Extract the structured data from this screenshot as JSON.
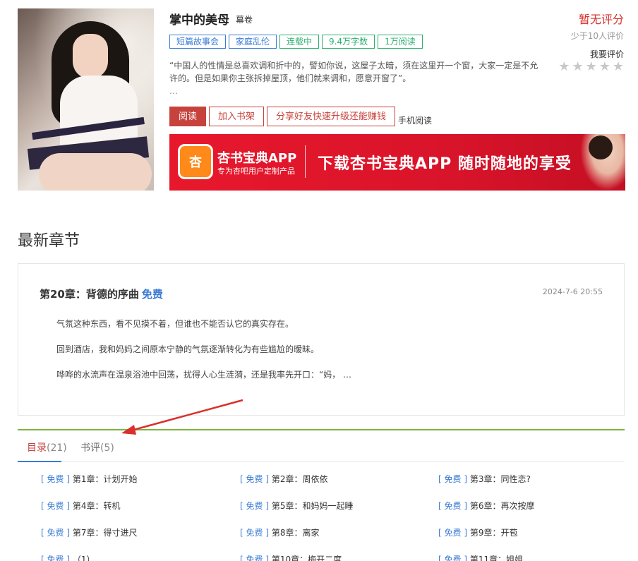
{
  "book": {
    "title": "掌中的美母",
    "author": "幕卷",
    "tags": [
      {
        "label": "短篇故事会",
        "color": "blue"
      },
      {
        "label": "家庭乱伦",
        "color": "blue"
      },
      {
        "label": "连载中",
        "color": "green"
      },
      {
        "label": "9.4万字数",
        "color": "green"
      },
      {
        "label": "1万阅读",
        "color": "green"
      }
    ],
    "description": "“中国人的性情是总喜欢调和折中的，譬如你说，这屋子太暗，须在这里开一个窗，大家一定是不允许的。但是如果你主张拆掉屋顶，他们就来调和，愿意开窗了”。",
    "description_more": "…",
    "actions": {
      "read": "阅读",
      "shelf": "加入书架",
      "share": "分享好友快速升级还能赚钱",
      "mobile": "手机阅读"
    }
  },
  "rating": {
    "title": "暂无评分",
    "count": "少于10人评价",
    "my": "我要评价",
    "stars": 0
  },
  "banner": {
    "logo": "杏",
    "name": "杏书宝典APP",
    "sub": "专为杏吧用户定制产品",
    "slogan": "下载杏书宝典APP 随时随地的享受"
  },
  "latest": {
    "section_title": "最新章节",
    "chapter": "第20章：背德的序曲",
    "free": "免费",
    "date": "2024-7-6 20:55",
    "paragraphs": [
      "气氛这种东西，看不见摸不着，但谁也不能否认它的真实存在。",
      "回到酒店，我和妈妈之间原本宁静的气氛逐渐转化为有些尴尬的暧昧。",
      "哗哗的水流声在温泉浴池中回荡，扰得人心生涟漪，还是我率先开口：“妈，  …"
    ]
  },
  "toc": {
    "tabs": [
      {
        "label": "目录",
        "count": "(21)"
      },
      {
        "label": "书评",
        "count": "(5)"
      }
    ],
    "free_label": "免费",
    "chapters": [
      "第1章：计划开始",
      "第2章：周依依",
      "第3章：同性恋?",
      "第4章：转机",
      "第5章：和妈妈一起睡",
      "第6章：再次按摩",
      "第7章：得寸进尺",
      "第8章：离家",
      "第9章：开苞",
      "（1）",
      "第10章：梅开二度",
      "第11章：姐姐"
    ]
  },
  "colors": {
    "accent_red": "#c7423c",
    "link_blue": "#3a7bd5",
    "tag_green": "#2dae6e",
    "toc_border_green": "#7cb342",
    "annotation_arrow": "#d9302b"
  }
}
